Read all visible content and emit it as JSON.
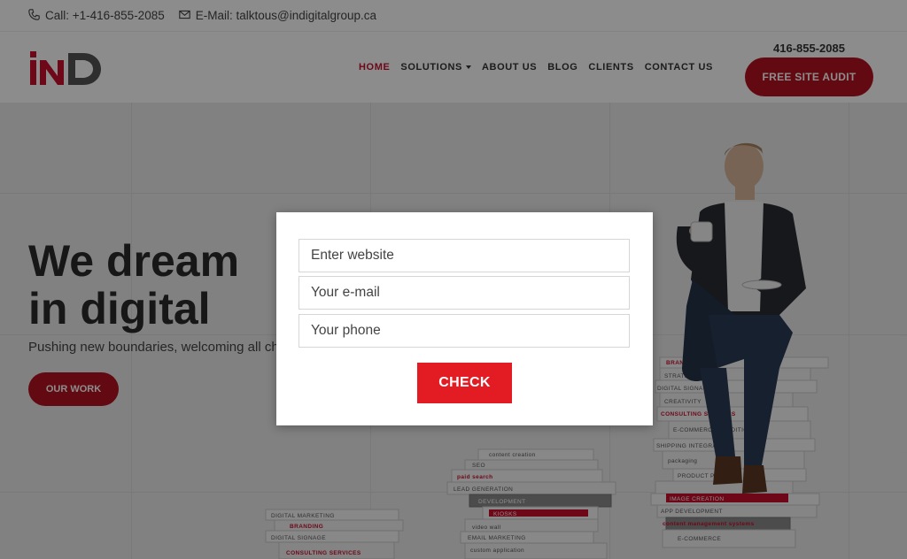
{
  "topbar": {
    "call_label": "Call: +1-416-855-2085",
    "email_label": "E-Mail:  talktous@indigitalgroup.ca"
  },
  "header": {
    "logo_text": "iND",
    "nav": [
      {
        "label": "HOME",
        "active": true
      },
      {
        "label": "SOLUTIONS",
        "has_dropdown": true
      },
      {
        "label": "ABOUT US"
      },
      {
        "label": "BLOG"
      },
      {
        "label": "CLIENTS"
      },
      {
        "label": "CONTACT US"
      }
    ],
    "phone": "416-855-2085",
    "audit_button": "FREE SITE AUDIT"
  },
  "hero": {
    "headline_line1": "We dream",
    "headline_line2": "in digital",
    "subline": "Pushing new boundaries, welcoming all cha",
    "our_work_button": "OUR WORK",
    "book_labels": [
      "DIGITAL MARKETING",
      "BRANDING",
      "DIGITAL SIGNAGE",
      "CONSULTING SERVICES",
      "content creation",
      "SEO",
      "paid search",
      "LEAD GENERATION",
      "DEVELOPMENT",
      "KIOSKS",
      "video wall",
      "EMAIL MARKETING",
      "custom application",
      "BRANDING",
      "STRATEGY",
      "DIGITAL SIGNAGE",
      "CREATIVITY",
      "CONSULTING SERVICES",
      "E-COMMERCE TRADITIONAL",
      "SHIPPING INTEGRATION",
      "packaging",
      "PRODUCT PL",
      "IMAGE CREATION",
      "APP DEVELOPMENT",
      "content management systems",
      "E-COMMERCE"
    ]
  },
  "modal": {
    "website_placeholder": "Enter website",
    "email_placeholder": "Your e-mail",
    "phone_placeholder": "Your phone",
    "check_button": "CHECK"
  },
  "colors": {
    "brand_red": "#b3121f",
    "button_red": "#e31b23",
    "overlay": "rgba(0,0,0,0.45)"
  }
}
